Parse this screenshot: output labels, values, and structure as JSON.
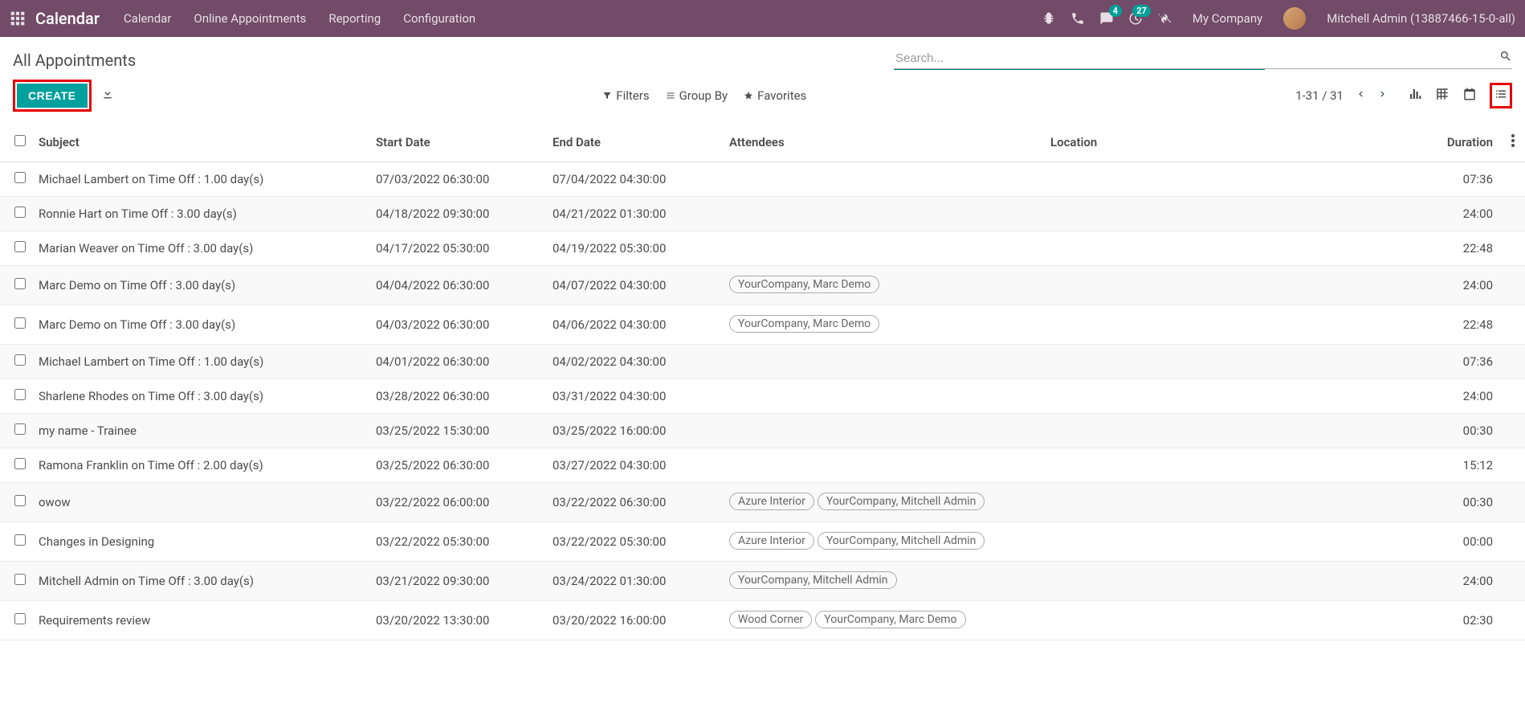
{
  "navbar": {
    "app_title": "Calendar",
    "links": [
      "Calendar",
      "Online Appointments",
      "Reporting",
      "Configuration"
    ],
    "messages_badge": "4",
    "activities_badge": "27",
    "company": "My Company",
    "user": "Mitchell Admin (13887466-15-0-all)"
  },
  "header": {
    "page_title": "All Appointments",
    "search_placeholder": "Search...",
    "create_label": "CREATE",
    "filters_label": "Filters",
    "groupby_label": "Group By",
    "favorites_label": "Favorites",
    "pager": "1-31 / 31"
  },
  "columns": {
    "subject": "Subject",
    "start": "Start Date",
    "end": "End Date",
    "attendees": "Attendees",
    "location": "Location",
    "duration": "Duration"
  },
  "rows": [
    {
      "subject": "Michael Lambert on Time Off : 1.00 day(s)",
      "start": "07/03/2022 06:30:00",
      "end": "07/04/2022 04:30:00",
      "attendees": [],
      "location": "",
      "duration": "07:36"
    },
    {
      "subject": "Ronnie Hart on Time Off : 3.00 day(s)",
      "start": "04/18/2022 09:30:00",
      "end": "04/21/2022 01:30:00",
      "attendees": [],
      "location": "",
      "duration": "24:00"
    },
    {
      "subject": "Marian Weaver on Time Off : 3.00 day(s)",
      "start": "04/17/2022 05:30:00",
      "end": "04/19/2022 05:30:00",
      "attendees": [],
      "location": "",
      "duration": "22:48"
    },
    {
      "subject": "Marc Demo on Time Off : 3.00 day(s)",
      "start": "04/04/2022 06:30:00",
      "end": "04/07/2022 04:30:00",
      "attendees": [
        "YourCompany, Marc Demo"
      ],
      "location": "",
      "duration": "24:00"
    },
    {
      "subject": "Marc Demo on Time Off : 3.00 day(s)",
      "start": "04/03/2022 06:30:00",
      "end": "04/06/2022 04:30:00",
      "attendees": [
        "YourCompany, Marc Demo"
      ],
      "location": "",
      "duration": "22:48"
    },
    {
      "subject": "Michael Lambert on Time Off : 1.00 day(s)",
      "start": "04/01/2022 06:30:00",
      "end": "04/02/2022 04:30:00",
      "attendees": [],
      "location": "",
      "duration": "07:36"
    },
    {
      "subject": "Sharlene Rhodes on Time Off : 3.00 day(s)",
      "start": "03/28/2022 06:30:00",
      "end": "03/31/2022 04:30:00",
      "attendees": [],
      "location": "",
      "duration": "24:00"
    },
    {
      "subject": "my name - Trainee",
      "start": "03/25/2022 15:30:00",
      "end": "03/25/2022 16:00:00",
      "attendees": [],
      "location": "",
      "duration": "00:30"
    },
    {
      "subject": "Ramona Franklin on Time Off : 2.00 day(s)",
      "start": "03/25/2022 06:30:00",
      "end": "03/27/2022 04:30:00",
      "attendees": [],
      "location": "",
      "duration": "15:12"
    },
    {
      "subject": "owow",
      "start": "03/22/2022 06:00:00",
      "end": "03/22/2022 06:30:00",
      "attendees": [
        "Azure Interior",
        "YourCompany, Mitchell Admin"
      ],
      "location": "",
      "duration": "00:30"
    },
    {
      "subject": "Changes in Designing",
      "start": "03/22/2022 05:30:00",
      "end": "03/22/2022 05:30:00",
      "attendees": [
        "Azure Interior",
        "YourCompany, Mitchell Admin"
      ],
      "location": "",
      "duration": "00:00"
    },
    {
      "subject": "Mitchell Admin on Time Off : 3.00 day(s)",
      "start": "03/21/2022 09:30:00",
      "end": "03/24/2022 01:30:00",
      "attendees": [
        "YourCompany, Mitchell Admin"
      ],
      "location": "",
      "duration": "24:00"
    },
    {
      "subject": "Requirements review",
      "start": "03/20/2022 13:30:00",
      "end": "03/20/2022 16:00:00",
      "attendees": [
        "Wood Corner",
        "YourCompany, Marc Demo"
      ],
      "location": "",
      "duration": "02:30"
    }
  ]
}
